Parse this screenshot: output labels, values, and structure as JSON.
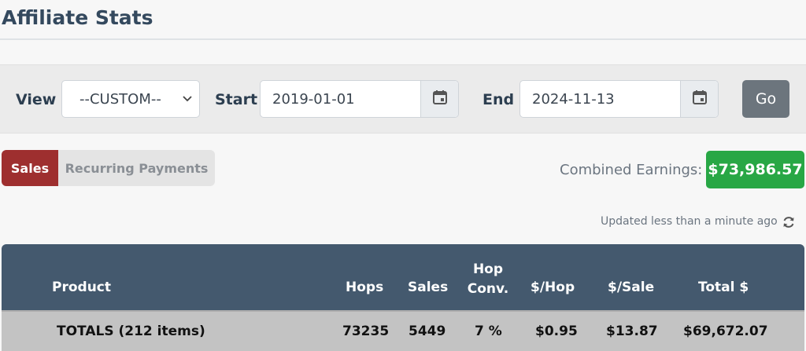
{
  "page": {
    "title": "Affiliate Stats"
  },
  "filters": {
    "view_label": "View",
    "view_value": "--CUSTOM--",
    "start_label": "Start",
    "start_value": "2019-01-01",
    "end_label": "End",
    "end_value": "2024-11-13",
    "go_label": "Go"
  },
  "tabs": [
    {
      "label": "Sales",
      "active": true
    },
    {
      "label": "Recurring Payments",
      "active": false
    }
  ],
  "earnings": {
    "label": "Combined Earnings:",
    "value": "$73,986.57"
  },
  "status": {
    "updated_text": "Updated less than a minute ago"
  },
  "table": {
    "headers": {
      "product": "Product",
      "hops": "Hops",
      "sales": "Sales",
      "hop_conv_line1": "Hop",
      "hop_conv_line2": "Conv.",
      "per_hop": "$/Hop",
      "per_sale": "$/Sale",
      "total": "Total $"
    },
    "totals": {
      "label": "TOTALS (212 items)",
      "hops": "73235",
      "sales": "5449",
      "hop_conv": "7 %",
      "per_hop": "$0.95",
      "per_sale": "$13.87",
      "total": "$69,672.07"
    }
  },
  "colors": {
    "accent_tab": "#9e2f2f",
    "earnings_badge": "#28a745",
    "table_header": "#44596e",
    "go_button": "#6c757d"
  }
}
